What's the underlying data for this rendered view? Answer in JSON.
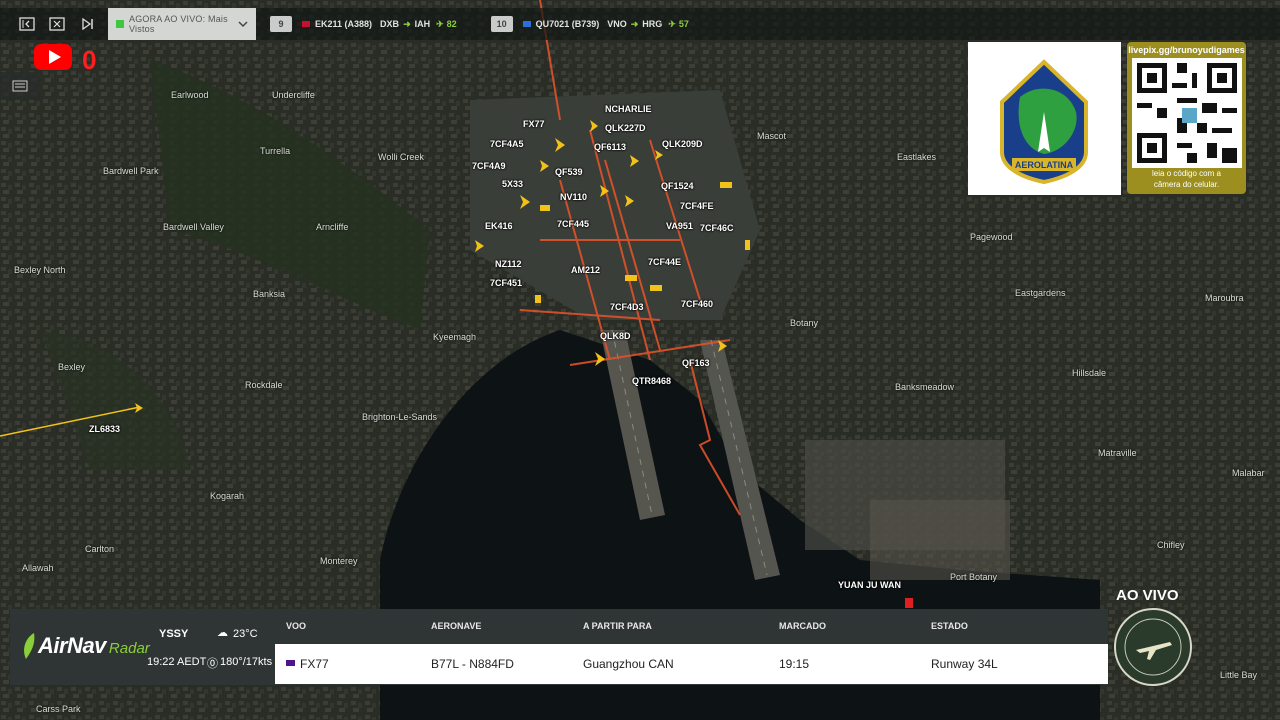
{
  "top_bar": {
    "live_select": "AGORA AO VIVO: Mais Vistos",
    "tickers": [
      {
        "index": "9",
        "flight": "EK211 (A388)",
        "from": "DXB",
        "to": "IAH",
        "alt": "82",
        "airline_color": "#c8102e"
      },
      {
        "index": "10",
        "flight": "QU7021 (B739)",
        "from": "VNO",
        "to": "HRG",
        "alt": "57",
        "airline_color": "#2a6fdb"
      }
    ]
  },
  "youtube": {
    "count": "0"
  },
  "qr": {
    "url": "livepix.gg/brunoyudigames",
    "hint_line1": "leia o código com a",
    "hint_line2": "câmera do celular."
  },
  "logo": {
    "text": "AEROLATINA"
  },
  "map_labels": {
    "earlwood": "Earlwood",
    "undercliffe": "Undercliffe",
    "turrella": "Turrella",
    "wolli_creek": "Wolli Creek",
    "mascot": "Mascot",
    "eastlakes": "Eastlakes",
    "bardwell_park": "Bardwell Park",
    "bardwell_valley": "Bardwell Valley",
    "arncliffe": "Arncliffe",
    "bexley_north": "Bexley North",
    "banksia": "Banksia",
    "pagewood": "Pagewood",
    "eastgardens": "Eastgardens",
    "maroubra": "Maroubra",
    "botany": "Botany",
    "kyeemagh": "Kyeemagh",
    "bexley": "Bexley",
    "rockdale": "Rockdale",
    "banksmeadow": "Banksmeadow",
    "hillsdale": "Hillsdale",
    "brighton": "Brighton-Le-Sands",
    "kogarah": "Kogarah",
    "carlton": "Carlton",
    "matraville": "Matraville",
    "allawah": "Allawah",
    "monterey": "Monterey",
    "port_botany": "Port Botany",
    "chifley": "Chifley",
    "malabar": "Malabar",
    "little_bay": "Little Bay",
    "carss_park": "Carss Park"
  },
  "flights": [
    "FX77",
    "NCHARLIE",
    "QLK227D",
    "7CF4A5",
    "QF6113",
    "QLK209D",
    "7CF4A9",
    "QF539",
    "5X33",
    "NV110",
    "QF1524",
    "7CF4FE",
    "EK416",
    "7CF445",
    "VA951",
    "7CF46C",
    "NZ112",
    "7CF44E",
    "AM212",
    "7CF451",
    "7CF4D3",
    "7CF460",
    "QLK8D",
    "QF163",
    "QTR8468",
    "ZL6833",
    "YUAN JU WAN"
  ],
  "bottom": {
    "brand_main": "AirNav",
    "brand_sub": "Radar",
    "airport": "YSSY",
    "time": "19:22 AEDT",
    "temp": "23°C",
    "wind": "180°/17kts",
    "headers": {
      "flight": "VOO",
      "aircraft": "AERONAVE",
      "from": "A PARTIR PARA",
      "scheduled": "MARCADO",
      "status": "ESTADO"
    },
    "row": {
      "flight": "FX77",
      "aircraft": "B77L - N884FD",
      "from": "Guangzhou CAN",
      "scheduled": "19:15",
      "status": "Runway 34L"
    }
  },
  "ao_vivo": "AO VIVO",
  "colors": {
    "accent_green": "#8acf3a",
    "track": "#e0522a",
    "plane": "#f2c21a",
    "youtube": "#ff0000"
  }
}
